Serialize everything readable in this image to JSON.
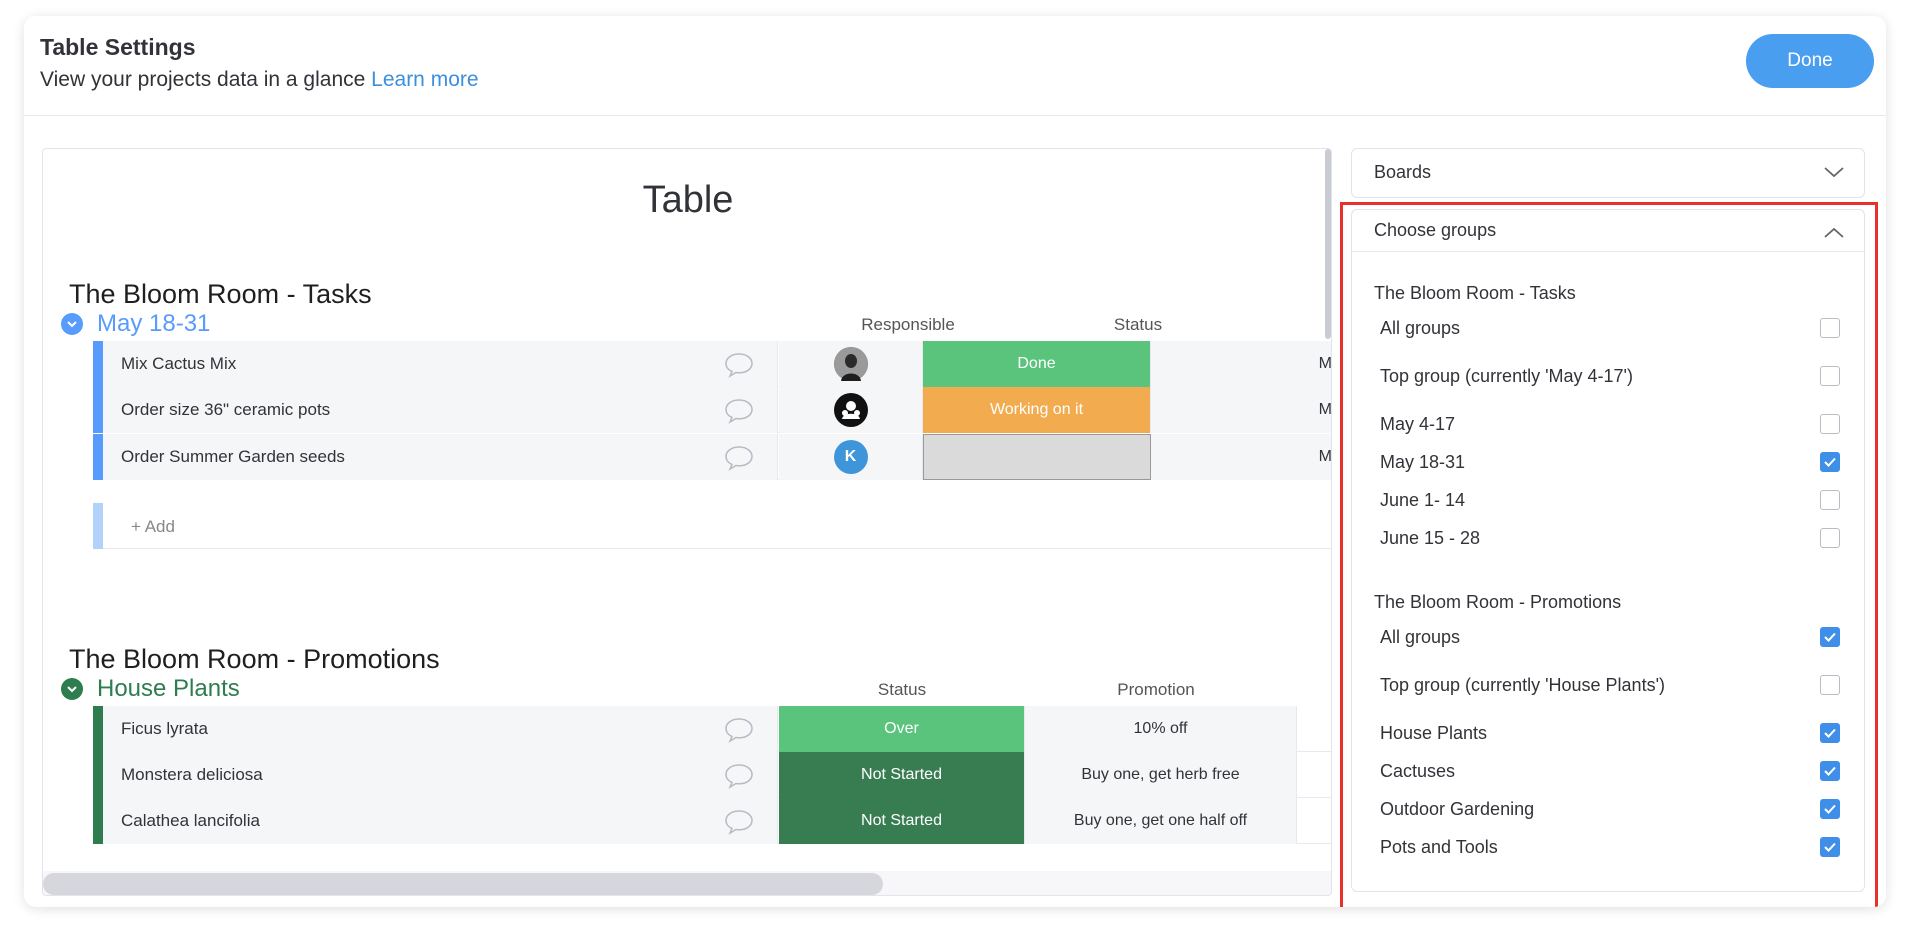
{
  "header": {
    "title": "Table Settings",
    "subtitle": "View your projects data in a glance",
    "learn_more": "Learn more",
    "done_label": "Done"
  },
  "preview": {
    "title": "Table",
    "board1": {
      "title": "The Bloom Room - Tasks",
      "group_name": "May 18-31",
      "group_color": "#579bfc",
      "columns": [
        "Responsible",
        "Status"
      ],
      "rows": [
        {
          "name": "Mix Cactus Mix",
          "avatar": "photo",
          "status": "Done",
          "status_color": "#5ac47d",
          "extra": "M"
        },
        {
          "name": "Order size 36\" ceramic pots",
          "avatar": "person-icon",
          "status": "Working on it",
          "status_color": "#f2ac4f",
          "extra": "M"
        },
        {
          "name": "Order Summer Garden seeds",
          "avatar": "K",
          "status": "",
          "status_color": "#dadada",
          "extra": "M"
        }
      ],
      "add_label": "+ Add"
    },
    "board2": {
      "title": "The Bloom Room - Promotions",
      "group_name": "House Plants",
      "group_color": "#2e7d4f",
      "columns": [
        "Status",
        "Promotion"
      ],
      "rows": [
        {
          "name": "Ficus lyrata",
          "status": "Over",
          "status_color": "#5ac47d",
          "promotion": "10% off"
        },
        {
          "name": "Monstera deliciosa",
          "status": "Not Started",
          "status_color": "#387d52",
          "promotion": "Buy one, get herb free"
        },
        {
          "name": "Calathea lancifolia",
          "status": "Not Started",
          "status_color": "#387d52",
          "promotion": "Buy one, get one half off"
        }
      ]
    }
  },
  "panel": {
    "boards_label": "Boards",
    "choose_groups_label": "Choose groups",
    "section1": {
      "title": "The Bloom Room - Tasks",
      "options": [
        {
          "label": "All groups",
          "checked": false
        },
        {
          "label": "Top group (currently 'May 4-17')",
          "checked": false
        },
        {
          "label": "May 4-17",
          "checked": false
        },
        {
          "label": "May 18-31",
          "checked": true
        },
        {
          "label": "June 1- 14",
          "checked": false
        },
        {
          "label": "June 15 - 28",
          "checked": false
        }
      ]
    },
    "section2": {
      "title": "The Bloom Room - Promotions",
      "options": [
        {
          "label": "All groups",
          "checked": true
        },
        {
          "label": "Top group (currently 'House Plants')",
          "checked": false
        },
        {
          "label": "House Plants",
          "checked": true
        },
        {
          "label": "Cactuses",
          "checked": true
        },
        {
          "label": "Outdoor Gardening",
          "checked": true
        },
        {
          "label": "Pots and Tools",
          "checked": true
        }
      ]
    }
  },
  "colors": {
    "accent": "#4a9ef0",
    "highlight": "#e8312a"
  }
}
